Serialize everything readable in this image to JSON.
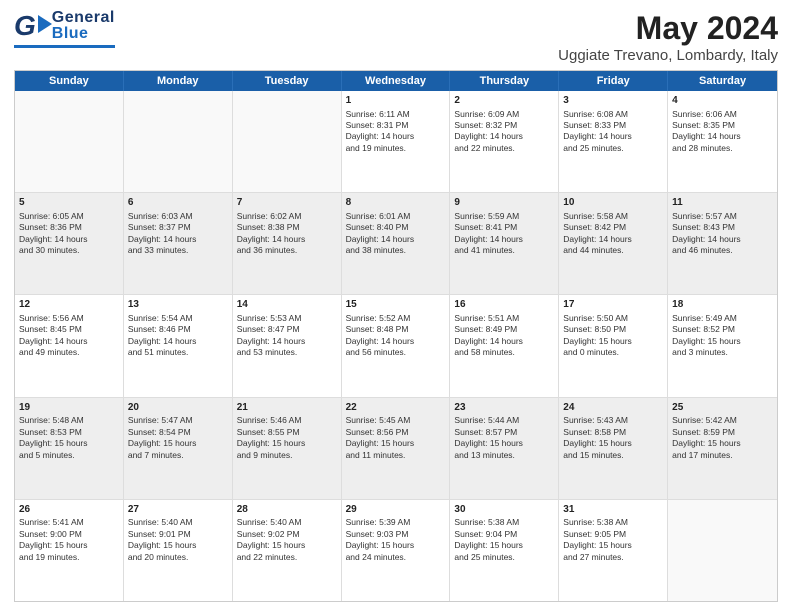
{
  "header": {
    "logo": {
      "general": "General",
      "blue": "Blue"
    },
    "title": "May 2024",
    "subtitle": "Uggiate Trevano, Lombardy, Italy"
  },
  "calendar": {
    "days": [
      "Sunday",
      "Monday",
      "Tuesday",
      "Wednesday",
      "Thursday",
      "Friday",
      "Saturday"
    ],
    "rows": [
      [
        {
          "day": "",
          "info": "",
          "empty": true
        },
        {
          "day": "",
          "info": "",
          "empty": true
        },
        {
          "day": "",
          "info": "",
          "empty": true
        },
        {
          "day": "1",
          "info": "Sunrise: 6:11 AM\nSunset: 8:31 PM\nDaylight: 14 hours\nand 19 minutes.",
          "empty": false
        },
        {
          "day": "2",
          "info": "Sunrise: 6:09 AM\nSunset: 8:32 PM\nDaylight: 14 hours\nand 22 minutes.",
          "empty": false
        },
        {
          "day": "3",
          "info": "Sunrise: 6:08 AM\nSunset: 8:33 PM\nDaylight: 14 hours\nand 25 minutes.",
          "empty": false
        },
        {
          "day": "4",
          "info": "Sunrise: 6:06 AM\nSunset: 8:35 PM\nDaylight: 14 hours\nand 28 minutes.",
          "empty": false
        }
      ],
      [
        {
          "day": "5",
          "info": "Sunrise: 6:05 AM\nSunset: 8:36 PM\nDaylight: 14 hours\nand 30 minutes.",
          "empty": false
        },
        {
          "day": "6",
          "info": "Sunrise: 6:03 AM\nSunset: 8:37 PM\nDaylight: 14 hours\nand 33 minutes.",
          "empty": false
        },
        {
          "day": "7",
          "info": "Sunrise: 6:02 AM\nSunset: 8:38 PM\nDaylight: 14 hours\nand 36 minutes.",
          "empty": false
        },
        {
          "day": "8",
          "info": "Sunrise: 6:01 AM\nSunset: 8:40 PM\nDaylight: 14 hours\nand 38 minutes.",
          "empty": false
        },
        {
          "day": "9",
          "info": "Sunrise: 5:59 AM\nSunset: 8:41 PM\nDaylight: 14 hours\nand 41 minutes.",
          "empty": false
        },
        {
          "day": "10",
          "info": "Sunrise: 5:58 AM\nSunset: 8:42 PM\nDaylight: 14 hours\nand 44 minutes.",
          "empty": false
        },
        {
          "day": "11",
          "info": "Sunrise: 5:57 AM\nSunset: 8:43 PM\nDaylight: 14 hours\nand 46 minutes.",
          "empty": false
        }
      ],
      [
        {
          "day": "12",
          "info": "Sunrise: 5:56 AM\nSunset: 8:45 PM\nDaylight: 14 hours\nand 49 minutes.",
          "empty": false
        },
        {
          "day": "13",
          "info": "Sunrise: 5:54 AM\nSunset: 8:46 PM\nDaylight: 14 hours\nand 51 minutes.",
          "empty": false
        },
        {
          "day": "14",
          "info": "Sunrise: 5:53 AM\nSunset: 8:47 PM\nDaylight: 14 hours\nand 53 minutes.",
          "empty": false
        },
        {
          "day": "15",
          "info": "Sunrise: 5:52 AM\nSunset: 8:48 PM\nDaylight: 14 hours\nand 56 minutes.",
          "empty": false
        },
        {
          "day": "16",
          "info": "Sunrise: 5:51 AM\nSunset: 8:49 PM\nDaylight: 14 hours\nand 58 minutes.",
          "empty": false
        },
        {
          "day": "17",
          "info": "Sunrise: 5:50 AM\nSunset: 8:50 PM\nDaylight: 15 hours\nand 0 minutes.",
          "empty": false
        },
        {
          "day": "18",
          "info": "Sunrise: 5:49 AM\nSunset: 8:52 PM\nDaylight: 15 hours\nand 3 minutes.",
          "empty": false
        }
      ],
      [
        {
          "day": "19",
          "info": "Sunrise: 5:48 AM\nSunset: 8:53 PM\nDaylight: 15 hours\nand 5 minutes.",
          "empty": false
        },
        {
          "day": "20",
          "info": "Sunrise: 5:47 AM\nSunset: 8:54 PM\nDaylight: 15 hours\nand 7 minutes.",
          "empty": false
        },
        {
          "day": "21",
          "info": "Sunrise: 5:46 AM\nSunset: 8:55 PM\nDaylight: 15 hours\nand 9 minutes.",
          "empty": false
        },
        {
          "day": "22",
          "info": "Sunrise: 5:45 AM\nSunset: 8:56 PM\nDaylight: 15 hours\nand 11 minutes.",
          "empty": false
        },
        {
          "day": "23",
          "info": "Sunrise: 5:44 AM\nSunset: 8:57 PM\nDaylight: 15 hours\nand 13 minutes.",
          "empty": false
        },
        {
          "day": "24",
          "info": "Sunrise: 5:43 AM\nSunset: 8:58 PM\nDaylight: 15 hours\nand 15 minutes.",
          "empty": false
        },
        {
          "day": "25",
          "info": "Sunrise: 5:42 AM\nSunset: 8:59 PM\nDaylight: 15 hours\nand 17 minutes.",
          "empty": false
        }
      ],
      [
        {
          "day": "26",
          "info": "Sunrise: 5:41 AM\nSunset: 9:00 PM\nDaylight: 15 hours\nand 19 minutes.",
          "empty": false
        },
        {
          "day": "27",
          "info": "Sunrise: 5:40 AM\nSunset: 9:01 PM\nDaylight: 15 hours\nand 20 minutes.",
          "empty": false
        },
        {
          "day": "28",
          "info": "Sunrise: 5:40 AM\nSunset: 9:02 PM\nDaylight: 15 hours\nand 22 minutes.",
          "empty": false
        },
        {
          "day": "29",
          "info": "Sunrise: 5:39 AM\nSunset: 9:03 PM\nDaylight: 15 hours\nand 24 minutes.",
          "empty": false
        },
        {
          "day": "30",
          "info": "Sunrise: 5:38 AM\nSunset: 9:04 PM\nDaylight: 15 hours\nand 25 minutes.",
          "empty": false
        },
        {
          "day": "31",
          "info": "Sunrise: 5:38 AM\nSunset: 9:05 PM\nDaylight: 15 hours\nand 27 minutes.",
          "empty": false
        },
        {
          "day": "",
          "info": "",
          "empty": true
        }
      ]
    ]
  }
}
